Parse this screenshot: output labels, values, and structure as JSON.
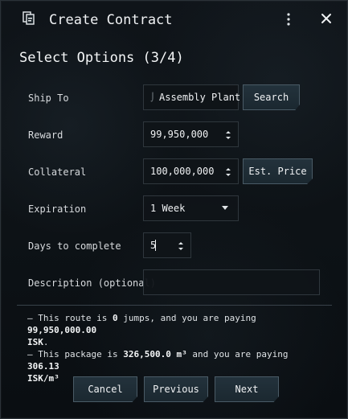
{
  "window": {
    "title": "Create Contract",
    "step_title": "Select Options (3/4)"
  },
  "fields": {
    "ship_to": {
      "label": "Ship To",
      "value": "Assembly Plant",
      "button": "Search"
    },
    "reward": {
      "label": "Reward",
      "value": "99,950,000"
    },
    "collateral": {
      "label": "Collateral",
      "value": "100,000,000",
      "button": "Est. Price"
    },
    "expiration": {
      "label": "Expiration",
      "value": "1 Week"
    },
    "days": {
      "label": "Days to complete",
      "value": "5"
    },
    "description": {
      "label": "Description (optional)",
      "value": ""
    }
  },
  "summary": {
    "route_prefix": "– This route is ",
    "jumps": "0",
    "route_middle": " jumps, and you are paying ",
    "route_amount": "99,950,000.00",
    "route_suffix": "ISK",
    "package_prefix": "– This package is ",
    "package_volume": "326,500.0 m³",
    "package_middle": " and you are paying ",
    "package_rate": "306.13",
    "package_suffix": "ISK/m³"
  },
  "footer": {
    "cancel": "Cancel",
    "previous": "Previous",
    "next": "Next"
  },
  "icons": {
    "app": "contract-icon",
    "menu": "kebab-icon",
    "close": "close-icon",
    "spinner": "spinner-icon",
    "dropdown": "chevron-down-icon"
  },
  "colors": {
    "background": "#0d1216",
    "button": "#23323c",
    "button_border": "#4a5b66",
    "text": "#f0f2f4"
  }
}
